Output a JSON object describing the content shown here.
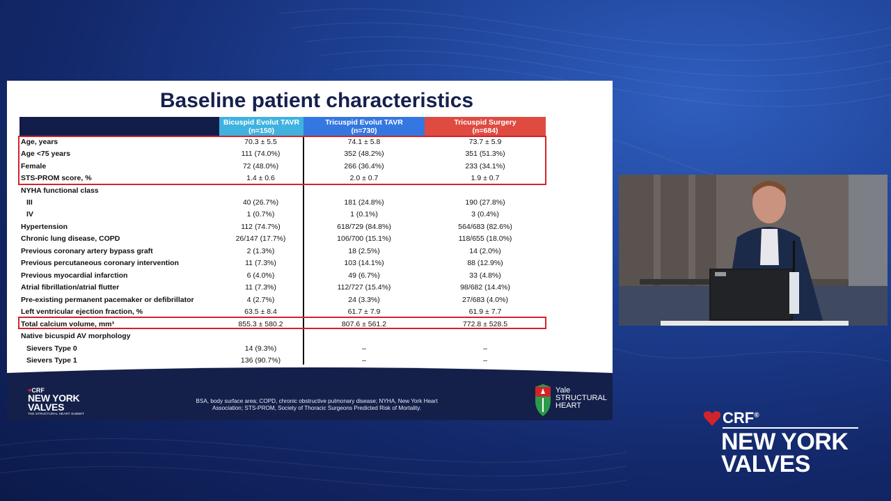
{
  "slide": {
    "title": "Baseline patient characteristics",
    "columns": [
      {
        "name": "Bicuspid Evolut TAVR",
        "n": "(n=150)",
        "color": "#3fb2df"
      },
      {
        "name": "Tricuspid Evolut TAVR",
        "n": "(n=730)",
        "color": "#3477e0"
      },
      {
        "name": "Tricuspid Surgery",
        "n": "(n=684)",
        "color": "#df4b41"
      }
    ],
    "rows": [
      {
        "label": "Age, years",
        "v": [
          "70.3 ± 5.5",
          "74.1 ± 5.8",
          "73.7 ± 5.9"
        ]
      },
      {
        "label": "Age <75 years",
        "v": [
          "111 (74.0%)",
          "352 (48.2%)",
          "351 (51.3%)"
        ]
      },
      {
        "label": "Female",
        "v": [
          "72 (48.0%)",
          "266 (36.4%)",
          "233 (34.1%)"
        ]
      },
      {
        "label": "STS-PROM score, %",
        "v": [
          "1.4 ± 0.6",
          "2.0 ± 0.7",
          "1.9 ± 0.7"
        ]
      },
      {
        "label": "NYHA functional class",
        "v": [
          "",
          "",
          ""
        ]
      },
      {
        "label": "III",
        "v": [
          "40 (26.7%)",
          "181 (24.8%)",
          "190 (27.8%)"
        ],
        "indent": true
      },
      {
        "label": "IV",
        "v": [
          "1 (0.7%)",
          "1 (0.1%)",
          "3 (0.4%)"
        ],
        "indent": true
      },
      {
        "label": "Hypertension",
        "v": [
          "112 (74.7%)",
          "618/729 (84.8%)",
          "564/683 (82.6%)"
        ]
      },
      {
        "label": "Chronic lung disease, COPD",
        "v": [
          "26/147 (17.7%)",
          "106/700 (15.1%)",
          "118/655 (18.0%)"
        ]
      },
      {
        "label": "Previous coronary artery bypass graft",
        "v": [
          "2 (1.3%)",
          "18 (2.5%)",
          "14 (2.0%)"
        ]
      },
      {
        "label": "Previous percutaneous coronary intervention",
        "v": [
          "11 (7.3%)",
          "103 (14.1%)",
          "88 (12.9%)"
        ]
      },
      {
        "label": "Previous myocardial infarction",
        "v": [
          "6 (4.0%)",
          "49 (6.7%)",
          "33 (4.8%)"
        ]
      },
      {
        "label": "Atrial fibrillation/atrial flutter",
        "v": [
          "11 (7.3%)",
          "112/727 (15.4%)",
          "98/682 (14.4%)"
        ]
      },
      {
        "label": "Pre-existing permanent pacemaker or defibrillator",
        "v": [
          "4 (2.7%)",
          "24 (3.3%)",
          "27/683 (4.0%)"
        ]
      },
      {
        "label": "Left ventricular ejection fraction, %",
        "v": [
          "63.5 ± 8.4",
          "61.7 ± 7.9",
          "61.9 ± 7.7"
        ]
      },
      {
        "label": "Total calcium volume, mm³",
        "v": [
          "855.3 ± 580.2",
          "807.6 ± 561.2",
          "772.8 ± 528.5"
        ]
      },
      {
        "label": "Native bicuspid AV morphology",
        "v": [
          "",
          "",
          ""
        ]
      },
      {
        "label": "Sievers Type 0",
        "v": [
          "14 (9.3%)",
          "–",
          "–"
        ],
        "indent": true
      },
      {
        "label": "Sievers Type 1",
        "v": [
          "136 (90.7%)",
          "–",
          "–"
        ],
        "indent": true
      }
    ],
    "footnote": "BSA, body surface area; COPD, chronic obstructive pulmonary disease; NYHA, New York Heart Association; STS-PROM, Society of Thoracic Surgeons Predicted Risk of Mortality.",
    "footer_logo": {
      "crf": "CRF",
      "line1": "NEW YORK",
      "line2": "VALVES",
      "tagline": "THE STRUCTURAL HEART SUMMIT"
    },
    "yale_logo": {
      "line1": "Yale",
      "line2": "STRUCTURAL",
      "line3": "HEART"
    }
  },
  "overlay_logo": {
    "crf": "CRF",
    "registered": "®",
    "line1": "NEW YORK",
    "line2": "VALVES"
  },
  "colors": {
    "accent_red": "#d2232a",
    "navy": "#131d4a"
  }
}
